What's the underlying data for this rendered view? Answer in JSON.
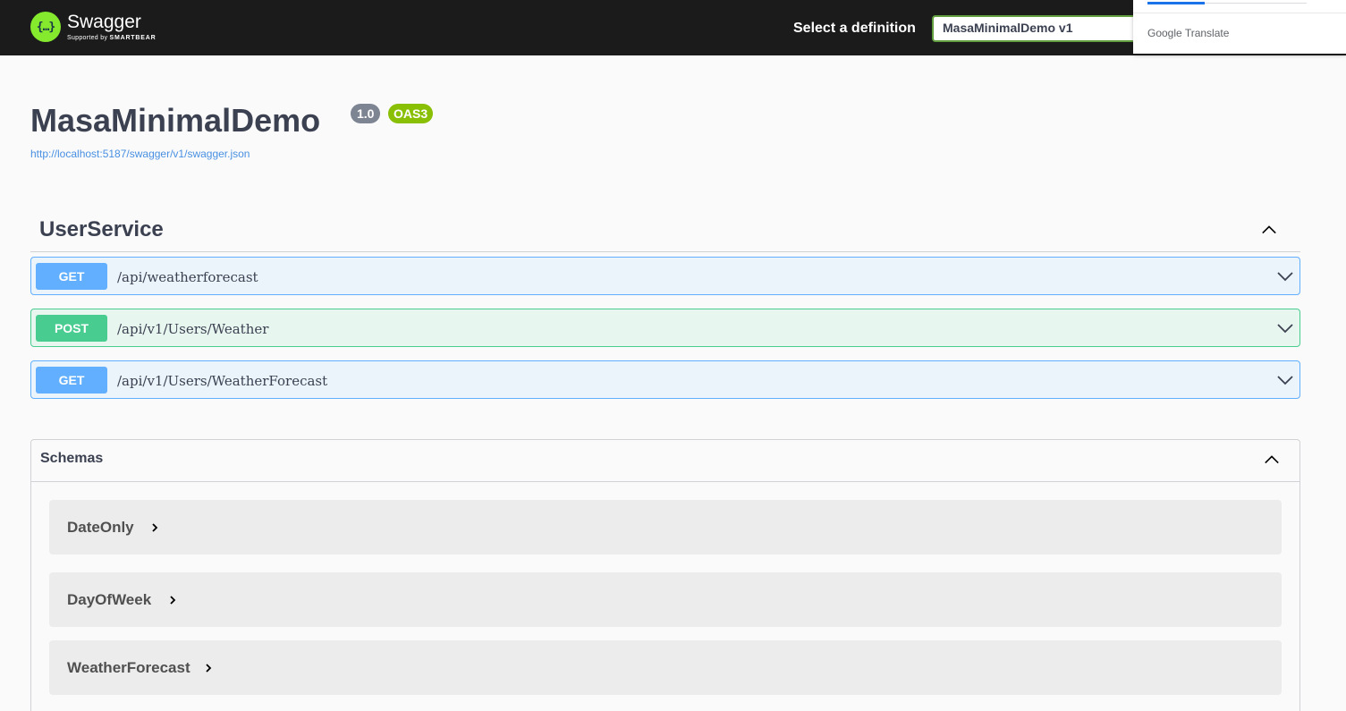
{
  "topbar": {
    "logo_glyph": "{…}",
    "logo_name": "Swagger",
    "logo_sub_prefix": "Supported by",
    "logo_sub_brand": "SMARTBEAR",
    "definition_label": "Select a definition",
    "definition_value": "MasaMinimalDemo v1"
  },
  "google_translate": {
    "label_google": "Google",
    "label_translate": "Translate"
  },
  "info": {
    "title": "MasaMinimalDemo",
    "version": "1.0",
    "oas": "OAS3",
    "spec_url": "http://localhost:5187/swagger/v1/swagger.json"
  },
  "tag": {
    "name": "UserService",
    "operations": [
      {
        "method": "GET",
        "path": "/api/weatherforecast"
      },
      {
        "method": "POST",
        "path": "/api/v1/Users/Weather"
      },
      {
        "method": "GET",
        "path": "/api/v1/Users/WeatherForecast"
      }
    ]
  },
  "schemas": {
    "title": "Schemas",
    "models": [
      {
        "name": "DateOnly"
      },
      {
        "name": "DayOfWeek"
      },
      {
        "name": "WeatherForecast"
      }
    ]
  },
  "colors": {
    "get": "#61affe",
    "post": "#49cc90",
    "accent_green": "#89bf04",
    "topbar": "#1b1b1b"
  },
  "icons": {
    "tag_toggle": "chevron-up-icon",
    "op_toggle": "chevron-down-icon",
    "model_expand": "chevron-right-icon"
  }
}
